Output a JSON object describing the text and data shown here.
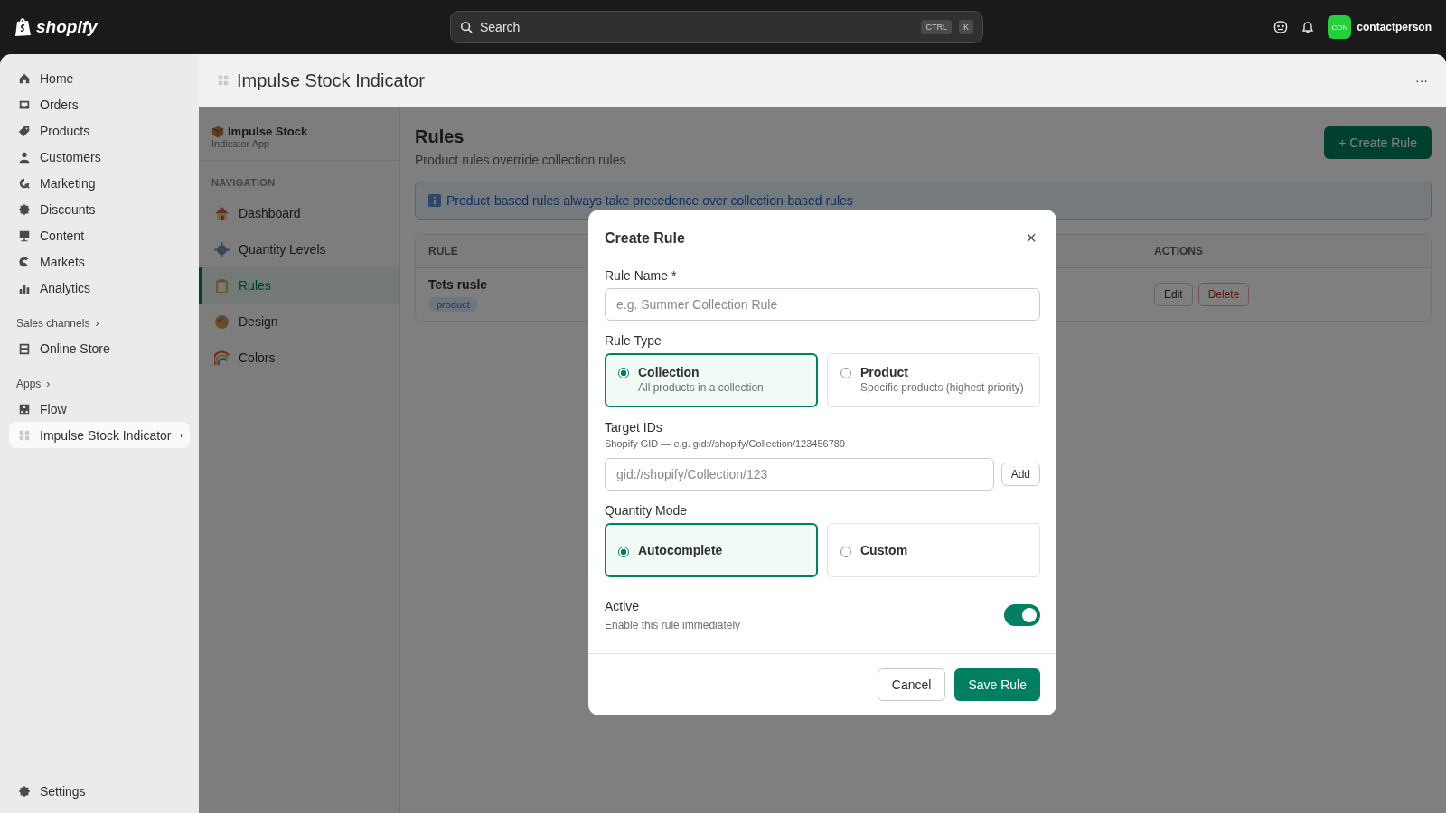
{
  "topbar": {
    "logo": "shopify",
    "search": {
      "placeholder": "Search",
      "keys": [
        "CTRL",
        "K"
      ]
    },
    "avatar": "CON",
    "user": "contactperson"
  },
  "sidebar": {
    "items": [
      {
        "label": "Home",
        "selected": false
      },
      {
        "label": "Orders",
        "selected": false
      },
      {
        "label": "Products",
        "selected": false
      },
      {
        "label": "Customers",
        "selected": false
      },
      {
        "label": "Marketing",
        "selected": false
      },
      {
        "label": "Discounts",
        "selected": false
      },
      {
        "label": "Content",
        "selected": false
      },
      {
        "label": "Markets",
        "selected": false
      },
      {
        "label": "Analytics",
        "selected": false
      }
    ],
    "sections": [
      {
        "title": "Sales channels",
        "chevron": "›",
        "items": [
          {
            "label": "Online Store",
            "selected": false
          }
        ]
      },
      {
        "title": "Apps",
        "chevron": "›",
        "items": [
          {
            "label": "Flow",
            "selected": false
          },
          {
            "label": "Impulse Stock Indicator",
            "selected": true
          }
        ]
      }
    ],
    "settings": "Settings"
  },
  "app_header": {
    "title": "Impulse Stock Indicator",
    "more": "···"
  },
  "app_nav": {
    "brand": "Impulse Stock",
    "brand_sub": "Indicator App",
    "heading": "NAVIGATION",
    "items": [
      {
        "label": "Dashboard",
        "selected": false
      },
      {
        "label": "Quantity Levels",
        "selected": false
      },
      {
        "label": "Rules",
        "selected": true
      },
      {
        "label": "Design",
        "selected": false
      },
      {
        "label": "Colors",
        "selected": false
      }
    ]
  },
  "page": {
    "title": "Rules",
    "subtitle": "Product rules override collection rules",
    "create_button": "+ Create Rule",
    "banner": "Product-based rules always take precedence over collection-based rules",
    "table": {
      "columns": [
        "RULE",
        "ACTIONS"
      ],
      "rows": [
        {
          "name": "Tets rusle",
          "tag": "product",
          "actions": [
            "Edit",
            "Delete"
          ]
        }
      ]
    }
  },
  "modal": {
    "title": "Create Rule",
    "close": "×",
    "rule_name": {
      "label": "Rule Name *",
      "placeholder": "e.g. Summer Collection Rule"
    },
    "rule_type": {
      "label": "Rule Type",
      "options": [
        {
          "title": "Collection",
          "description": "All products in a collection",
          "selected": true
        },
        {
          "title": "Product",
          "description": "Specific products (highest priority)",
          "selected": false
        }
      ]
    },
    "target_ids": {
      "label": "Target IDs",
      "hint": "Shopify GID — e.g. gid://shopify/Collection/123456789",
      "placeholder": "gid://shopify/Collection/123",
      "add": "Add"
    },
    "quantity_mode": {
      "label": "Quantity Mode",
      "options": [
        {
          "title": "Autocomplete",
          "selected": true
        },
        {
          "title": "Custom",
          "selected": false
        }
      ]
    },
    "active": {
      "label": "Active",
      "description": "Enable this rule immediately",
      "on": true
    },
    "buttons": {
      "cancel": "Cancel",
      "save": "Save Rule"
    }
  }
}
